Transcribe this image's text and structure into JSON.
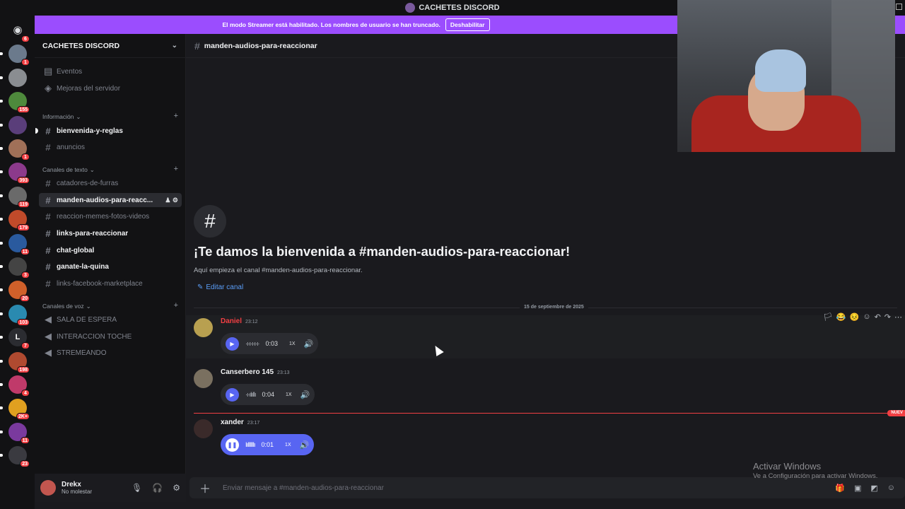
{
  "window": {
    "title": "CACHETES DISCORD"
  },
  "banner": {
    "text": "El modo Streamer está habilitado. Los nombres de usuario se han truncado.",
    "button": "Deshabilitar"
  },
  "servers": [
    {
      "badge": "6",
      "color": "#5865f2",
      "icon": "discord-home-icon"
    },
    {
      "badge": "1",
      "color": "#6b7a8c"
    },
    {
      "badge": "",
      "color": "#8a8d91"
    },
    {
      "badge": "155",
      "color": "#4e8a3c"
    },
    {
      "badge": "",
      "color": "#5a3e7a"
    },
    {
      "badge": "1",
      "color": "#a07058"
    },
    {
      "badge": "393",
      "color": "#8c3a8c"
    },
    {
      "badge": "119",
      "color": "#6a6a6a"
    },
    {
      "badge": "179",
      "color": "#c04a2a"
    },
    {
      "badge": "11",
      "color": "#2a5a9e"
    },
    {
      "badge": "3",
      "color": "#444"
    },
    {
      "badge": "20",
      "color": "#d0602a"
    },
    {
      "badge": "103",
      "color": "#2a8ab0"
    },
    {
      "badge": "7",
      "color": "#2b2c31",
      "letter": "L"
    },
    {
      "badge": "198",
      "color": "#b04a30"
    },
    {
      "badge": "4",
      "color": "#c03a6a"
    },
    {
      "badge": "2K+",
      "color": "#e0a020"
    },
    {
      "badge": "11",
      "color": "#7a3a9e"
    },
    {
      "badge": "23",
      "color": "#3a3a40"
    }
  ],
  "sidebar": {
    "server_name": "CACHETES DISCORD",
    "top_items": [
      {
        "label": "Eventos",
        "icon": "calendar-icon"
      },
      {
        "label": "Mejoras del servidor",
        "icon": "boost-icon"
      }
    ],
    "categories": {
      "info": "Información",
      "text": "Canales de texto",
      "voice": "Canales de voz"
    },
    "info_channels": [
      {
        "name": "bienvenida-y-reglas",
        "unread": true
      },
      {
        "name": "anuncios",
        "unread": false
      }
    ],
    "text_channels": [
      {
        "name": "catadores-de-furras",
        "unread": false
      },
      {
        "name": "manden-audios-para-reacc...",
        "unread": true,
        "active": true
      },
      {
        "name": "reaccion-memes-fotos-videos",
        "unread": false
      },
      {
        "name": "links-para-reaccionar",
        "unread": true
      },
      {
        "name": "chat-global",
        "unread": true
      },
      {
        "name": "ganate-la-quina",
        "unread": true
      },
      {
        "name": "links-facebook-marketplace",
        "unread": false
      }
    ],
    "voice_channels": [
      {
        "name": "SALA DE ESPERA"
      },
      {
        "name": "INTERACCION TOCHE"
      },
      {
        "name": "STREMEANDO"
      }
    ]
  },
  "user": {
    "name": "Drekx",
    "status": "No molestar"
  },
  "channel": {
    "name": "manden-audios-para-reaccionar",
    "welcome_title": "¡Te damos la bienvenida a #manden-audios-para-reaccionar!",
    "welcome_sub": "Aquí empieza el canal #manden-audios-para-reaccionar.",
    "edit_label": "Editar canal",
    "date_divider": "15 de septiembre de 2025"
  },
  "messages": [
    {
      "author": "Daniel",
      "author_color": "#f23f43",
      "time": "23:12",
      "duration": "0:03",
      "speed": "1X",
      "playing": false,
      "avatar_color": "#b8a050"
    },
    {
      "author": "Canserbero 145",
      "author_color": "#f2f3f5",
      "time": "23:13",
      "duration": "0:04",
      "speed": "1X",
      "playing": false,
      "avatar_color": "#7a7060"
    },
    {
      "author": "xander",
      "author_color": "#f2f3f5",
      "time": "23:17",
      "duration": "0:01",
      "speed": "1X",
      "playing": true,
      "avatar_color": "#3a2a2a"
    }
  ],
  "new_tag": "NUEV",
  "composer": {
    "placeholder": "Enviar mensaje a #manden-audios-para-reaccionar"
  },
  "watermark": {
    "title": "Activar Windows",
    "sub": "Ve a Configuración para activar Windows."
  }
}
